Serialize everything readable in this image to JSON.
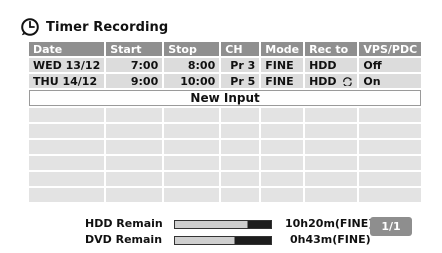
{
  "window": {
    "title": "Timer Recording"
  },
  "table": {
    "headers": [
      "Date",
      "Start",
      "Stop",
      "CH",
      "Mode",
      "Rec to",
      "VPS/PDC"
    ],
    "rows": [
      {
        "date": "WED 13/12",
        "start": "7:00",
        "stop": "8:00",
        "ch": "Pr 3",
        "mode": "FINE",
        "rec_to": "HDD",
        "vps": "Off"
      },
      {
        "date": "THU 14/12",
        "start": "9:00",
        "stop": "10:00",
        "ch": "Pr 5",
        "mode": "FINE",
        "rec_to": "HDD",
        "vps": "On"
      }
    ],
    "new_input_label": "New Input",
    "empty_rows": 6
  },
  "footer": {
    "hdd": {
      "label": "HDD Remain",
      "value": "10h20m(FINE)",
      "fill_fraction": 0.76
    },
    "dvd": {
      "label": "DVD Remain",
      "value": "0h43m(FINE)",
      "fill_fraction": 0.62
    }
  },
  "page_indicator": "1/1",
  "icons": {
    "title_icon": "timer-clock-icon",
    "repeat_icon": "repeat-arrow-icon"
  }
}
